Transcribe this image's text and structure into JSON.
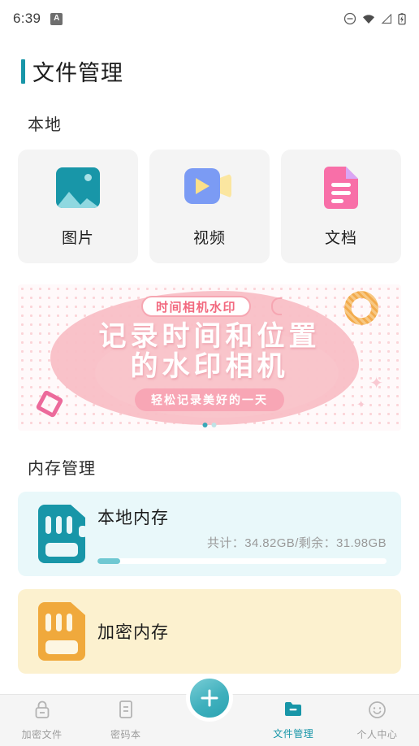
{
  "status_bar": {
    "time": "6:39",
    "app_icon_letter": "A",
    "icons": [
      "dnd-icon",
      "wifi-icon",
      "signal-icon",
      "battery-charging-icon"
    ]
  },
  "header": {
    "title": "文件管理",
    "accent_color": "#1896a8"
  },
  "local_section": {
    "title": "本地",
    "cards": [
      {
        "label": "图片",
        "icon": "image-icon",
        "color": "#1896a8"
      },
      {
        "label": "视频",
        "icon": "video-icon",
        "color": "#7b9bf4"
      },
      {
        "label": "文档",
        "icon": "document-icon",
        "color": "#f86fa8"
      }
    ]
  },
  "banner": {
    "badge": "时间相机水印",
    "headline_line1": "记录时间和位置",
    "headline_line2": "的水印相机",
    "subtitle": "轻松记录美好的一天",
    "dots_total": 2,
    "dot_active_index": 0,
    "accent_color": "#f8a6b5"
  },
  "storage_section": {
    "title": "内存管理",
    "cards": [
      {
        "name": "本地内存",
        "meta": "共计：34.82GB/剩余：31.98GB",
        "total": "34.82GB",
        "free": "31.98GB",
        "used_percent": 8,
        "icon": "sd-card-icon",
        "bg_color": "#e9f8fa",
        "icon_color": "#1896a8"
      },
      {
        "name": "加密内存",
        "meta": "",
        "used_percent": 0,
        "icon": "sd-card-icon",
        "bg_color": "#fcf1cf",
        "icon_color": "#f0a93c"
      }
    ]
  },
  "bottom_nav": {
    "items": [
      {
        "label": "加密文件",
        "icon": "lock-icon",
        "active": false
      },
      {
        "label": "密码本",
        "icon": "notebook-icon",
        "active": false
      },
      {
        "label": "文件管理",
        "icon": "folder-icon",
        "active": true
      },
      {
        "label": "个人中心",
        "icon": "smiley-face-icon",
        "active": false
      }
    ],
    "fab": {
      "icon": "plus-icon",
      "color": "#3fb0bd"
    },
    "active_color": "#1896a8",
    "inactive_color": "#9b9b9b"
  }
}
